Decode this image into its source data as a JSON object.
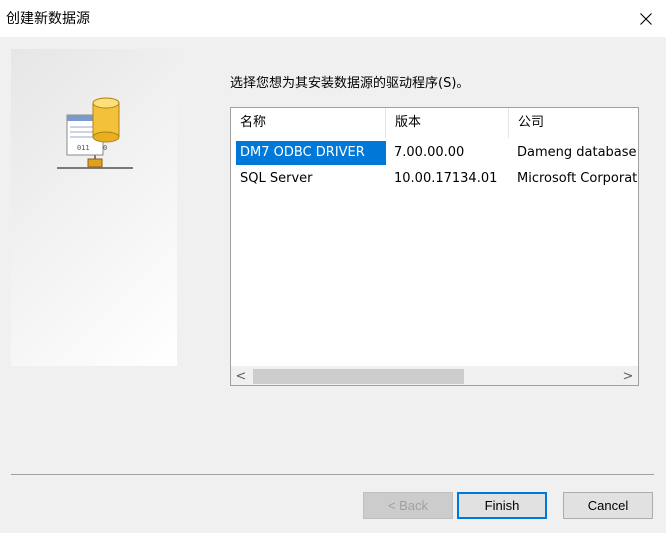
{
  "window": {
    "title": "创建新数据源",
    "close_icon": "close-icon"
  },
  "instruction": "选择您想为其安装数据源的驱动程序(S)。",
  "columns": [
    "名称",
    "版本",
    "公司"
  ],
  "drivers": [
    {
      "name": "DM7 ODBC DRIVER",
      "version": "7.00.00.00",
      "company": "Dameng database",
      "selected": true
    },
    {
      "name": "SQL Server",
      "version": "10.00.17134.01",
      "company": "Microsoft Corporation",
      "selected": false
    }
  ],
  "scroll": {
    "left": "<",
    "right": ">"
  },
  "buttons": {
    "back": "< Back",
    "finish": "Finish",
    "cancel": "Cancel"
  },
  "colors": {
    "selection": "#0078d7",
    "default_button_border": "#0078d7"
  }
}
